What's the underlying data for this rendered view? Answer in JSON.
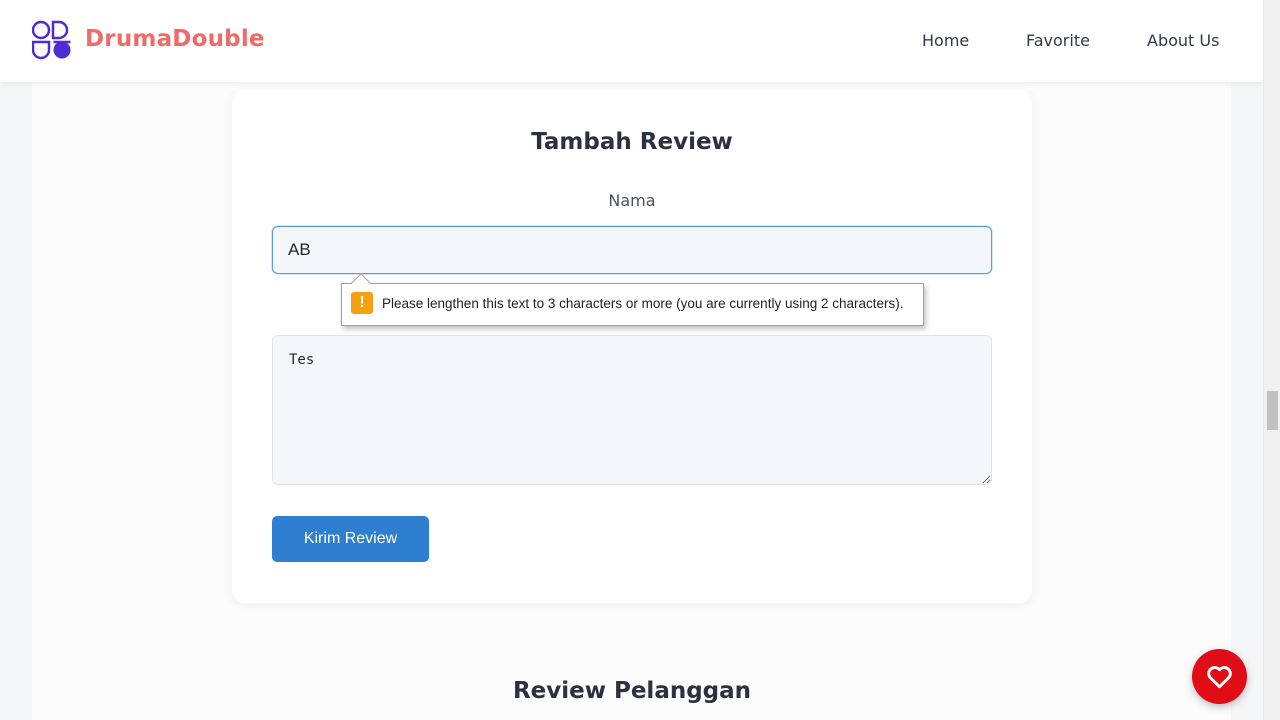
{
  "header": {
    "brand": "DrumaDouble",
    "nav": {
      "home": "Home",
      "favorite": "Favorite",
      "about": "About Us"
    }
  },
  "form": {
    "title": "Tambah Review",
    "name_label": "Nama",
    "name_value": "AB",
    "review_value": "Tes",
    "submit_label": "Kirim Review"
  },
  "validation": {
    "message": "Please lengthen this text to 3 characters or more (you are currently using 2 characters).",
    "icon": "warning-icon"
  },
  "reviews": {
    "title": "Review Pelanggan"
  },
  "colors": {
    "brand": "#f06a6a",
    "logo": "#4f2bd6",
    "button": "#2f7fd0",
    "favorite_button": "#e00d16"
  }
}
